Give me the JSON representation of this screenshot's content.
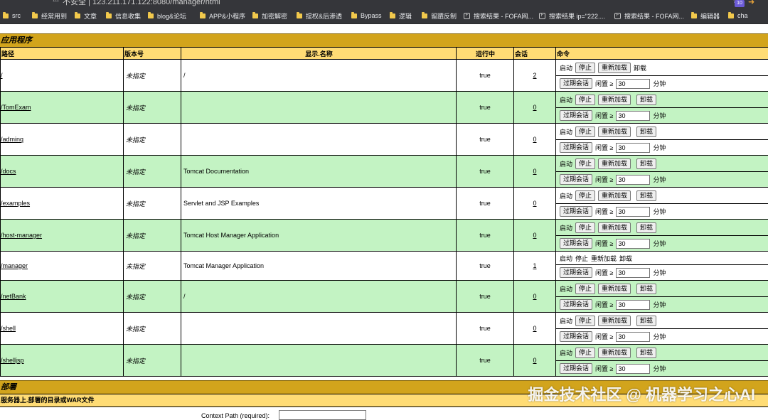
{
  "browser": {
    "security_label": "不安全",
    "address": "123.211.171.122:8080/manager/html"
  },
  "bookmarks": [
    {
      "label": "src",
      "icon": "folder-icon"
    },
    {
      "label": "经常用到",
      "icon": "folder-icon"
    },
    {
      "label": "文章",
      "icon": "folder-icon"
    },
    {
      "label": "信息收集",
      "icon": "folder-icon"
    },
    {
      "label": "blog&论坛",
      "icon": "folder-icon"
    },
    {
      "label": "APP&小程序",
      "icon": "folder-icon"
    },
    {
      "label": "加密解密",
      "icon": "folder-icon"
    },
    {
      "label": "提权&后渗透",
      "icon": "folder-icon"
    },
    {
      "label": "Bypass",
      "icon": "folder-icon"
    },
    {
      "label": "逻辑",
      "icon": "folder-icon"
    },
    {
      "label": "留蹟反制",
      "icon": "folder-icon"
    },
    {
      "label": "搜索结果 - FOFA网...",
      "icon": "page-icon"
    },
    {
      "label": "搜索结果 ip=\"222....",
      "icon": "page-icon"
    },
    {
      "label": "搜索结果 - FOFA网...",
      "icon": "page-icon"
    },
    {
      "label": "编辑器",
      "icon": "folder-icon"
    },
    {
      "label": "cha",
      "icon": "folder-icon"
    }
  ],
  "extension_badge": "10",
  "applications": {
    "section_title": "应用程序",
    "headers": {
      "path": "路径",
      "version": "版本号",
      "display_name": "显示.名称",
      "running": "运行中",
      "sessions": "会话",
      "commands": "命令"
    },
    "cmd_labels": {
      "start": "启动",
      "stop": "停止",
      "reload": "重新加载",
      "undeploy": "卸载",
      "expire": "过期会话",
      "idle": "闲置 ≥",
      "minutes": "分钟",
      "idle_value": "30"
    },
    "rows": [
      {
        "path": "/",
        "version": "未指定",
        "name": "/",
        "running": "true",
        "sessions": "2"
      },
      {
        "path": "/TomExam",
        "version": "未指定",
        "name": "",
        "running": "true",
        "sessions": "0"
      },
      {
        "path": "/adminq",
        "version": "未指定",
        "name": "",
        "running": "true",
        "sessions": "0"
      },
      {
        "path": "/docs",
        "version": "未指定",
        "name": "Tomcat Documentation",
        "running": "true",
        "sessions": "0"
      },
      {
        "path": "/examples",
        "version": "未指定",
        "name": "Servlet and JSP Examples",
        "running": "true",
        "sessions": "0"
      },
      {
        "path": "/host-manager",
        "version": "未指定",
        "name": "Tomcat Host Manager Application",
        "running": "true",
        "sessions": "0"
      },
      {
        "path": "/manager",
        "version": "未指定",
        "name": "Tomcat Manager Application",
        "running": "true",
        "sessions": "1"
      },
      {
        "path": "/netBank",
        "version": "未指定",
        "name": "/",
        "running": "true",
        "sessions": "0"
      },
      {
        "path": "/shell",
        "version": "未指定",
        "name": "",
        "running": "true",
        "sessions": "0"
      },
      {
        "path": "/shelljsp",
        "version": "未指定",
        "name": "",
        "running": "true",
        "sessions": "0"
      }
    ]
  },
  "deploy": {
    "section_title": "部署",
    "subtitle": "服务器上.部署的目录或WAR文件",
    "context_path_label": "Context Path (required):"
  },
  "watermark": "掘金技术社区 @ 机器学习之心AI"
}
